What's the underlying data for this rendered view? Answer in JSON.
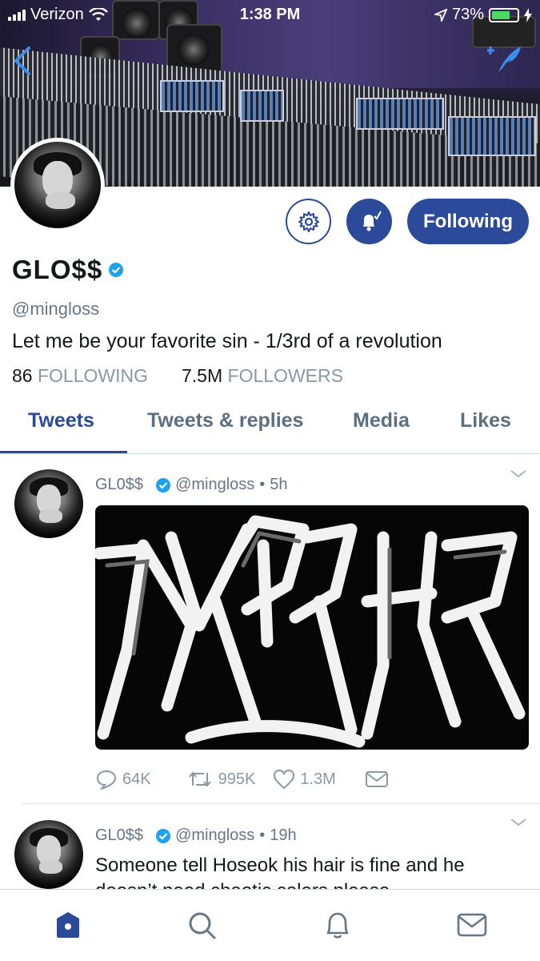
{
  "status_bar": {
    "carrier": "Verizon",
    "time": "1:38 PM",
    "battery": "73%",
    "battery_level": 0.73
  },
  "profile": {
    "name": "GLO$$",
    "handle": "@mingloss",
    "bio": "Let me be your favorite sin - 1/3rd of a revolution",
    "following_count": "86",
    "following_label": "FOLLOWING",
    "followers_count": "7.5M",
    "followers_label": "FOLLOWERS",
    "follow_button": "Following"
  },
  "tabs": [
    {
      "label": "Tweets",
      "active": true
    },
    {
      "label": "Tweets & replies",
      "active": false
    },
    {
      "label": "Media",
      "active": false
    },
    {
      "label": "Likes",
      "active": false
    }
  ],
  "tweets": [
    {
      "name": "GL0$$",
      "handle": "@mingloss",
      "separator": "•",
      "time": "5h",
      "replies": "64K",
      "retweets": "995K",
      "likes": "1.3M"
    },
    {
      "name": "GL0$$",
      "handle": "@mingloss",
      "separator": "•",
      "time": "19h",
      "text": "Someone tell Hoseok his hair is fine and he doesn’t need chaotic colors please"
    }
  ],
  "colors": {
    "accent": "#2b4a99",
    "verified": "#1da1f2",
    "muted": "#657786"
  }
}
